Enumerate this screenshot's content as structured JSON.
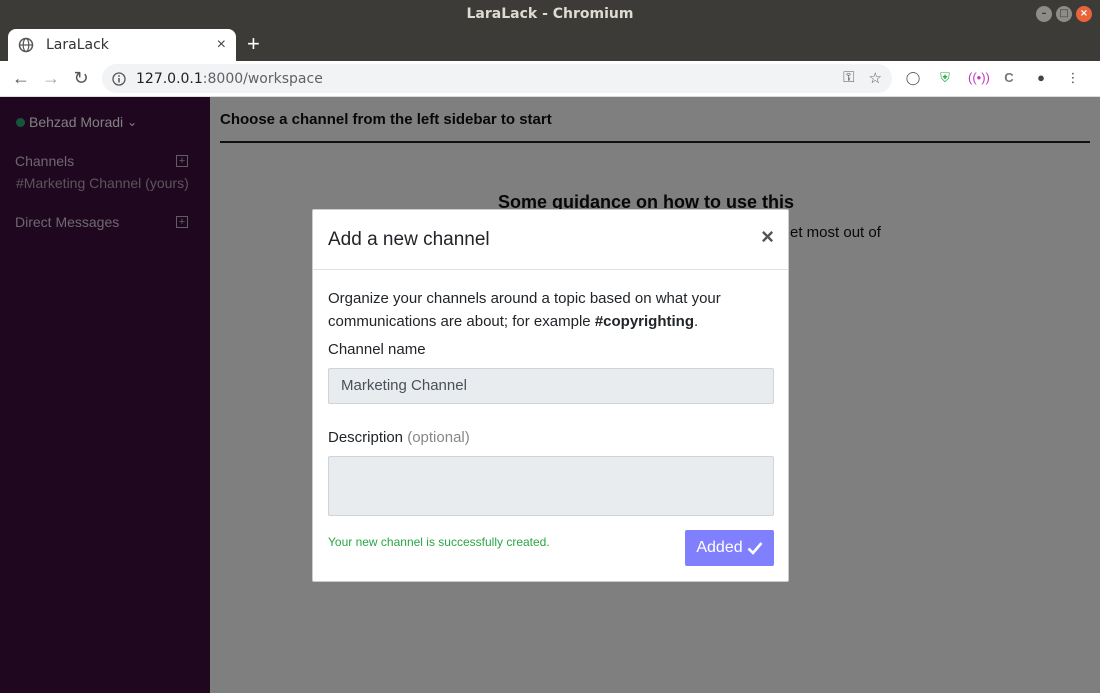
{
  "window": {
    "title": "LaraLack - Chromium"
  },
  "tab": {
    "title": "LaraLack",
    "close": "×",
    "newtab": "+"
  },
  "address": {
    "host": "127.0.0.1",
    "path": ":8000/workspace"
  },
  "sidebar": {
    "user": "Behzad Moradi",
    "channels_label": "Channels",
    "channel_items": [
      "#Marketing Channel (yours)"
    ],
    "dm_label": "Direct Messages",
    "bg_color": "#3f0e40",
    "status_color": "#2bac76"
  },
  "main": {
    "heading": "Choose a channel from the left sidebar to start",
    "guidance_title": "Some guidance on how to use this",
    "guidance_fragment": "et most out of"
  },
  "modal": {
    "title": "Add a new channel",
    "close": "×",
    "intro_text": "Organize your channels around a topic based on what your communications are about; for example ",
    "intro_example": "#copyrighting",
    "intro_end": ".",
    "channel_name_label": "Channel name",
    "channel_name_value": "Marketing Channel",
    "description_label": "Description",
    "description_optional": "(optional)",
    "description_value": "",
    "success_message": "Your new channel is successfully created.",
    "added_button": "Added",
    "success_color": "#28a745",
    "button_color": "#8080ff"
  }
}
